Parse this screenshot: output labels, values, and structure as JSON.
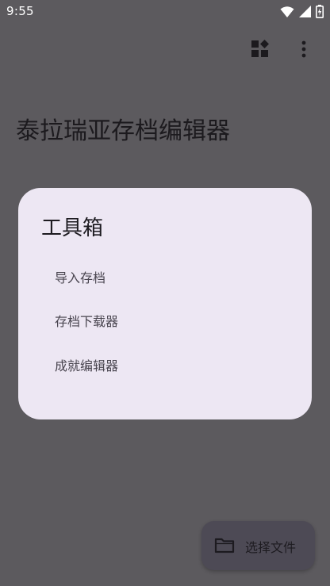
{
  "status_bar": {
    "time": "9:55",
    "icons": [
      "wifi-icon",
      "cellular-signal-icon",
      "battery-icon"
    ]
  },
  "app_bar": {
    "actions": [
      "widgets-icon",
      "more-vert-icon"
    ]
  },
  "page": {
    "title": "泰拉瑞亚存档编辑器"
  },
  "dialog": {
    "title": "工具箱",
    "items": [
      {
        "label": "导入存档"
      },
      {
        "label": "存档下载器"
      },
      {
        "label": "成就编辑器"
      }
    ]
  },
  "fab": {
    "label": "选择文件",
    "icon": "folder-icon"
  },
  "colors": {
    "scrim_background": "#5c5a5e",
    "dialog_surface": "#ede7f3",
    "fab_container": "#4d4a55",
    "on_surface": "#1d1b20",
    "on_surface_variant": "#49454f"
  }
}
